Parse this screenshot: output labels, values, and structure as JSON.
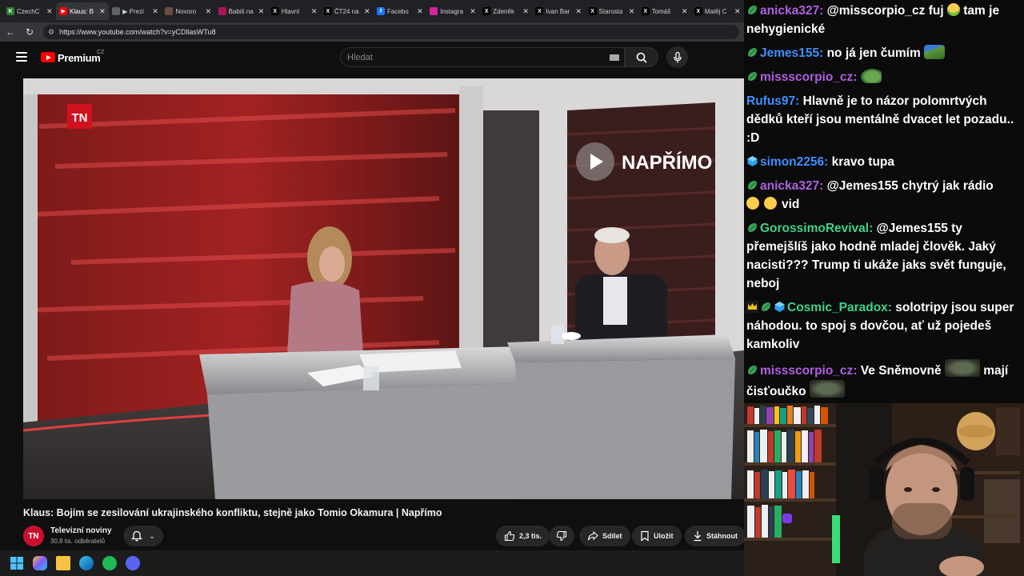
{
  "browser": {
    "tabs": [
      {
        "title": "CzechC",
        "favicon_color": "#2e7d32",
        "favicon_text": "K",
        "active": false
      },
      {
        "title": "Klaus: B",
        "favicon_color": "#ff0000",
        "favicon_text": "▶",
        "active": true
      },
      {
        "title": "▶ Prezi",
        "favicon_color": "#5f6368",
        "favicon_text": "",
        "active": false
      },
      {
        "title": "Novoro",
        "favicon_color": "#6d4c41",
        "favicon_text": "",
        "active": false
      },
      {
        "title": "Babiš na",
        "favicon_color": "#ad1457",
        "favicon_text": "",
        "active": false
      },
      {
        "title": "Hlavní",
        "favicon_color": "#000000",
        "favicon_text": "X",
        "active": false
      },
      {
        "title": "ČT24 na",
        "favicon_color": "#000000",
        "favicon_text": "X",
        "active": false
      },
      {
        "title": "Facebo",
        "favicon_color": "#1877f2",
        "favicon_text": "f",
        "active": false
      },
      {
        "title": "Instagra",
        "favicon_color": "#d6249f",
        "favicon_text": "",
        "active": false
      },
      {
        "title": "Zdeněk",
        "favicon_color": "#000000",
        "favicon_text": "X",
        "active": false
      },
      {
        "title": "Ivan Bar",
        "favicon_color": "#000000",
        "favicon_text": "X",
        "active": false
      },
      {
        "title": "Starosta",
        "favicon_color": "#000000",
        "favicon_text": "X",
        "active": false
      },
      {
        "title": "Tomáš",
        "favicon_color": "#000000",
        "favicon_text": "X",
        "active": false
      },
      {
        "title": "Matěj C",
        "favicon_color": "#000000",
        "favicon_text": "X",
        "active": false
      }
    ],
    "url": "https://www.youtube.com/watch?v=yCDllasWTu8"
  },
  "youtube": {
    "brand": "Premium",
    "country": "CZ",
    "search_placeholder": "Hledat",
    "video": {
      "title": "Klaus: Bojím se zesilování ukrajinského konfliktu, stejně jako Tomio Okamura | Napřímo",
      "overlay_logo": "TN",
      "overlay_show": "NAPŘÍMO"
    },
    "channel": {
      "avatar_text": "TN",
      "name": "Televizní noviny",
      "subscribers": "30,8 tis. odběratelů"
    },
    "actions": {
      "likes": "2,3 tis.",
      "share": "Sdílet",
      "save": "Uložit",
      "download": "Stáhnout"
    }
  },
  "chat": {
    "messages": [
      {
        "badges": [
          "green"
        ],
        "user": "anicka327",
        "user_color": "#b05fe0",
        "text": "@misscorpio_cz fuj",
        "emoji_after": "sick",
        "text2": "tam je nehygienické"
      },
      {
        "badges": [
          "green"
        ],
        "user": "Jemes155",
        "user_color": "#3f8fff",
        "text": "no já jen čumím",
        "emote_after": "pepe"
      },
      {
        "badges": [
          "green"
        ],
        "user": "missscorpio_cz",
        "user_color": "#b05fe0",
        "text": "",
        "emote_after": "frog"
      },
      {
        "badges": [],
        "user": "Rufus97",
        "user_color": "#3f8fff",
        "text": "Hlavně je to názor polomrtvých dědků kteří jsou mentálně dvacet let pozadu.. :D"
      },
      {
        "badges": [
          "blue"
        ],
        "user": "simon2256",
        "user_color": "#3f8fff",
        "text": "kravo tupa"
      },
      {
        "badges": [
          "green"
        ],
        "user": "anicka327",
        "user_color": "#b05fe0",
        "text": "@Jemes155 chytrý jak rádio",
        "emoji_row": "vid"
      },
      {
        "badges": [
          "green"
        ],
        "user": "GorossimoRevival",
        "user_color": "#3fd38a",
        "text": "@Jemes155 ty přemejšlíš jako hodně mladej člověk. Jaký nacisti??? Trump ti ukáže jaks svět funguje, neboj"
      },
      {
        "badges": [
          "crown",
          "green",
          "blue"
        ],
        "user": "Cosmic_Paradox",
        "user_color": "#3fd38a",
        "text": "solotripy jsou super náhodou. to spoj s dovčou, ať už pojedeš kamkoliv"
      },
      {
        "badges": [
          "green"
        ],
        "user": "missscorpio_cz",
        "user_color": "#b05fe0",
        "text": "Ve Sněmovně",
        "text2": "mají čisťoučko"
      }
    ]
  }
}
